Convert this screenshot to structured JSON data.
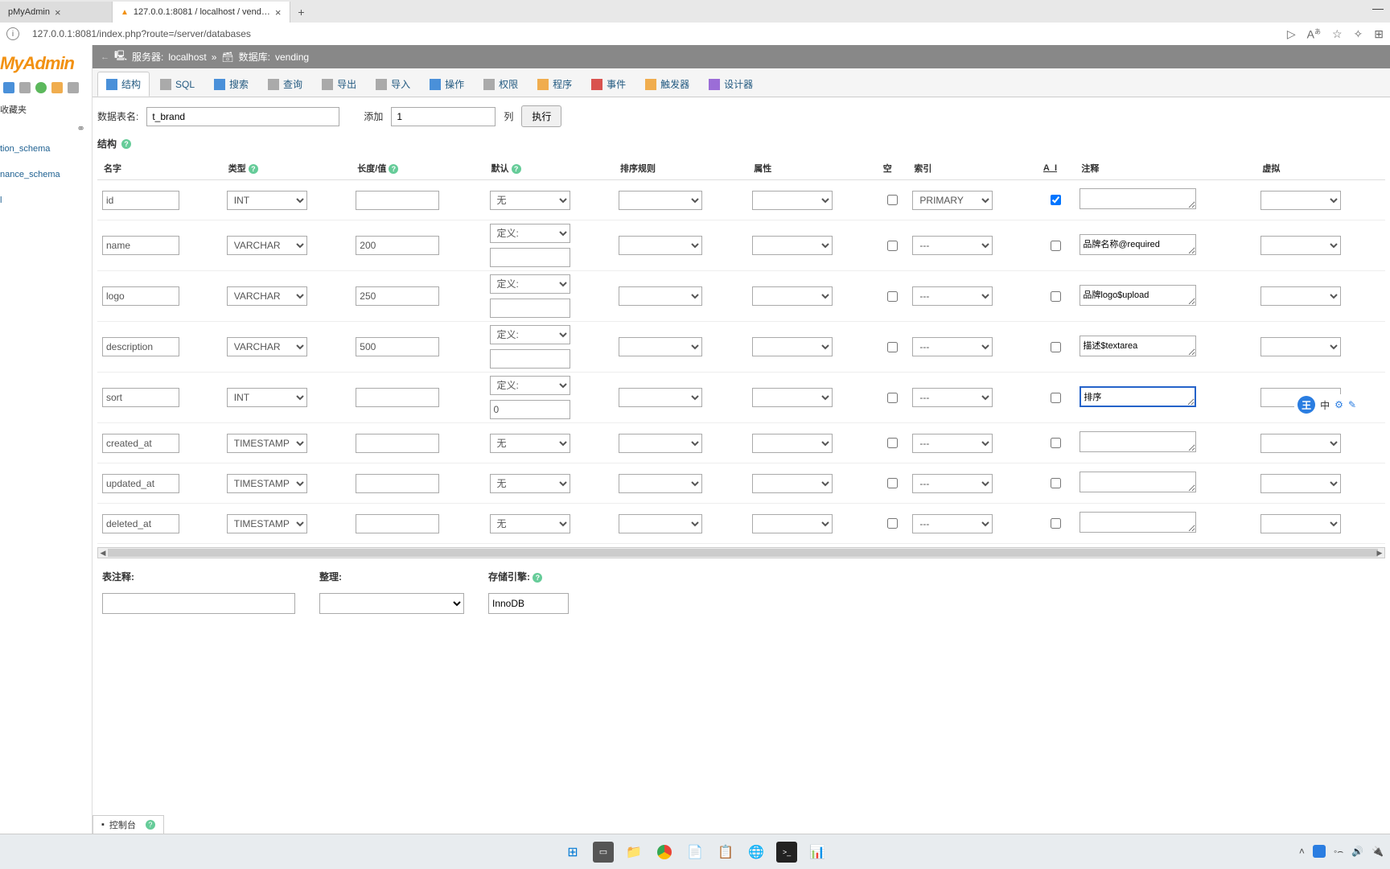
{
  "browser": {
    "tabs": [
      {
        "title": "pMyAdmin",
        "active": false
      },
      {
        "title": "127.0.0.1:8081 / localhost / vend…",
        "active": true
      }
    ],
    "url": "127.0.0.1:8081/index.php?route=/server/databases",
    "window_minimize": "—"
  },
  "sidebar": {
    "logo": "MyAdmin",
    "fav_label": "收藏夹",
    "databases": [
      "tion_schema",
      "nance_schema",
      "l"
    ]
  },
  "breadcrumb": {
    "server_label": "服务器:",
    "server_value": "localhost",
    "sep": "»",
    "db_label": "数据库:",
    "db_value": "vending"
  },
  "nav_tabs": [
    {
      "label": "结构",
      "active": true
    },
    {
      "label": "SQL",
      "active": false
    },
    {
      "label": "搜索",
      "active": false
    },
    {
      "label": "查询",
      "active": false
    },
    {
      "label": "导出",
      "active": false
    },
    {
      "label": "导入",
      "active": false
    },
    {
      "label": "操作",
      "active": false
    },
    {
      "label": "权限",
      "active": false
    },
    {
      "label": "程序",
      "active": false
    },
    {
      "label": "事件",
      "active": false
    },
    {
      "label": "触发器",
      "active": false
    },
    {
      "label": "设计器",
      "active": false
    }
  ],
  "form": {
    "table_name_label": "数据表名:",
    "table_name_value": "t_brand",
    "add_label": "添加",
    "add_count": "1",
    "columns_label": "列",
    "execute_label": "执行"
  },
  "section_title": "结构",
  "headers": {
    "name": "名字",
    "type": "类型",
    "length": "长度/值",
    "default": "默认",
    "collation": "排序规则",
    "attributes": "属性",
    "null": "空",
    "index": "索引",
    "ai": "A_I",
    "comment": "注释",
    "virtual": "虚拟"
  },
  "default_define": "定义:",
  "default_none": "无",
  "index_none": "---",
  "index_primary": "PRIMARY",
  "rows": [
    {
      "name": "id",
      "type": "INT",
      "len": "",
      "def_mode": "none",
      "def_val": "",
      "idx": "PRIMARY",
      "ai": true,
      "comment": "",
      "tall": false
    },
    {
      "name": "name",
      "type": "VARCHAR",
      "len": "200",
      "def_mode": "define",
      "def_val": "",
      "idx": "---",
      "ai": false,
      "comment": "品牌名称@required",
      "tall": true
    },
    {
      "name": "logo",
      "type": "VARCHAR",
      "len": "250",
      "def_mode": "define",
      "def_val": "",
      "idx": "---",
      "ai": false,
      "comment": "品牌logo$upload",
      "tall": true
    },
    {
      "name": "description",
      "type": "VARCHAR",
      "len": "500",
      "def_mode": "define",
      "def_val": "",
      "idx": "---",
      "ai": false,
      "comment": "描述$textarea",
      "tall": true
    },
    {
      "name": "sort",
      "type": "INT",
      "len": "",
      "def_mode": "define",
      "def_val": "0",
      "idx": "---",
      "ai": false,
      "comment": "排序",
      "tall": true,
      "focused": true
    },
    {
      "name": "created_at",
      "type": "TIMESTAMP",
      "len": "",
      "def_mode": "none",
      "def_val": "",
      "idx": "---",
      "ai": false,
      "comment": "",
      "tall": false
    },
    {
      "name": "updated_at",
      "type": "TIMESTAMP",
      "len": "",
      "def_mode": "none",
      "def_val": "",
      "idx": "---",
      "ai": false,
      "comment": "",
      "tall": false
    },
    {
      "name": "deleted_at",
      "type": "TIMESTAMP",
      "len": "",
      "def_mode": "none",
      "def_val": "",
      "idx": "---",
      "ai": false,
      "comment": "",
      "tall": false
    }
  ],
  "footer": {
    "comment_label": "表注释:",
    "collation_label": "整理:",
    "engine_label": "存储引擎:",
    "engine_value": "InnoDB"
  },
  "console_label": "控制台",
  "ime": {
    "badge": "王",
    "lang": "中"
  }
}
